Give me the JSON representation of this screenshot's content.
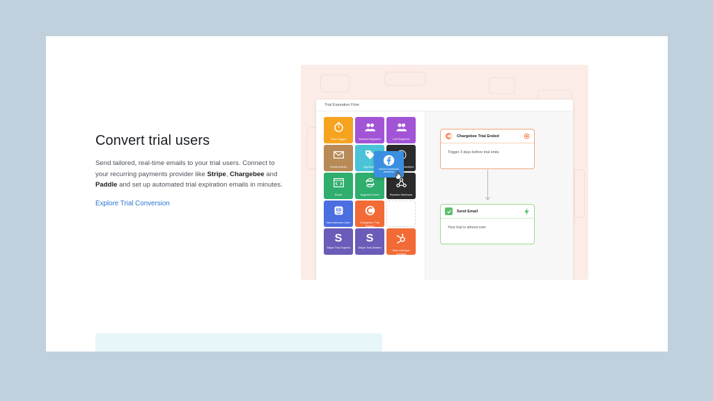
{
  "section": {
    "title": "Convert trial users",
    "desc_1": "Send tailored, real-time emails to your trial users. Connect to your recurring payments provider like ",
    "stripe": "Stripe",
    "comma": ", ",
    "chargebee": "Chargebee",
    "and": " and ",
    "paddle": "Paddle",
    "desc_2": " and set up automated trial expiration emails in minutes.",
    "link": "Explore Trial Conversion"
  },
  "app": {
    "title": "Trial Expiration Flow",
    "tiles": [
      {
        "label": "Time Trigger",
        "color": "#f6a31f",
        "icon": "stopwatch-icon"
      },
      {
        "label": "Entered Segment",
        "color": "#a254d6",
        "icon": "users-icon"
      },
      {
        "label": "Left Segment",
        "color": "#a254d6",
        "icon": "users-icon"
      },
      {
        "label": "Email Activity",
        "color": "#b78a57",
        "icon": "envelope-icon"
      },
      {
        "label": "Tag Added",
        "color": "#4ac3d6",
        "icon": "tag-icon"
      },
      {
        "label": "Typeform Submitted",
        "color": "#2b2b2b",
        "icon": "typeform-icon"
      },
      {
        "label": "Event",
        "color": "#2fae6e",
        "icon": "code-window-icon"
      },
      {
        "label": "Segment Event",
        "color": "#2fae6e",
        "icon": "segment-icon"
      },
      {
        "label": "Receive Webhook",
        "color": "#2b2b2b",
        "icon": "webhook-icon"
      },
      {
        "label": "New Intercom User",
        "color": "#4b6ee0",
        "icon": "intercom-icon"
      },
      {
        "label": "Chargebee Trial Started",
        "color": "#f26a35",
        "icon": "chargebee-icon"
      },
      {
        "label": "",
        "color": "transparent",
        "icon": "empty-slot"
      },
      {
        "label": "Stripe Trial Expired",
        "color": "#6a5cb8",
        "icon": "stripe-icon"
      },
      {
        "label": "Stripe Trial Started",
        "color": "#6a5cb8",
        "icon": "stripe-icon"
      },
      {
        "label": "New HubSpot Contact",
        "color": "#f26a35",
        "icon": "hubspot-icon"
      }
    ],
    "dragging_tile": {
      "label": "Add to Facebook Audience",
      "color": "#3a8fe0",
      "icon": "facebook-icon"
    },
    "node_trigger": {
      "title": "Chargebee Trial Ended",
      "body": "Trigger 3 days before trial ends.",
      "color": "#f0a577"
    },
    "node_email": {
      "title": "Send Email",
      "body": "Your trial is almost over",
      "color": "#9ed98e"
    }
  }
}
